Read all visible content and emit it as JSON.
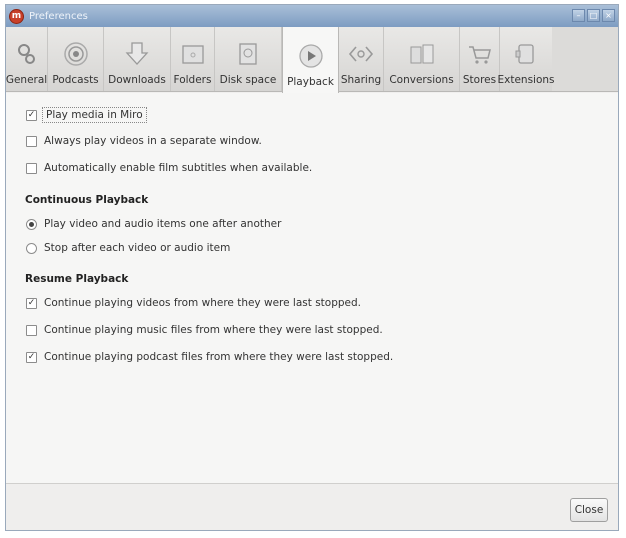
{
  "window": {
    "title": "Preferences"
  },
  "tabs": [
    {
      "label": "General",
      "icon": "gears-icon"
    },
    {
      "label": "Podcasts",
      "icon": "podcast-icon"
    },
    {
      "label": "Downloads",
      "icon": "download-arrow-icon"
    },
    {
      "label": "Folders",
      "icon": "folder-icon"
    },
    {
      "label": "Disk space",
      "icon": "disk-icon"
    },
    {
      "label": "Playback",
      "icon": "play-icon"
    },
    {
      "label": "Sharing",
      "icon": "sharing-icon"
    },
    {
      "label": "Conversions",
      "icon": "conversions-icon"
    },
    {
      "label": "Stores",
      "icon": "cart-icon"
    },
    {
      "label": "Extensions",
      "icon": "puzzle-icon"
    }
  ],
  "active_tab": "Playback",
  "playback": {
    "opt_play_in_miro": {
      "label": "Play media in Miro",
      "checked": true
    },
    "opt_separate_window": {
      "label": "Always play videos in a separate window.",
      "checked": false
    },
    "opt_subtitles": {
      "label": "Automatically enable film subtitles when available.",
      "checked": false
    }
  },
  "continuous": {
    "heading": "Continuous Playback",
    "opt_one_after_another": {
      "label": "Play video and audio items one after another",
      "selected": true
    },
    "opt_stop_after": {
      "label": "Stop after each video or audio item",
      "selected": false
    }
  },
  "resume": {
    "heading": "Resume Playback",
    "opt_videos": {
      "label": "Continue playing videos from where they were last stopped.",
      "checked": true
    },
    "opt_music": {
      "label": "Continue playing music files from where they were last stopped.",
      "checked": false
    },
    "opt_podcasts": {
      "label": "Continue playing podcast files from where they were last stopped.",
      "checked": true
    }
  },
  "footer": {
    "close_label": "Close"
  },
  "colors": {
    "titlebar": "#8aa6c8",
    "app_icon": "#c8402a",
    "tab_bg": "#dcdbd9",
    "active_tab_bg": "#f7f7f6"
  }
}
